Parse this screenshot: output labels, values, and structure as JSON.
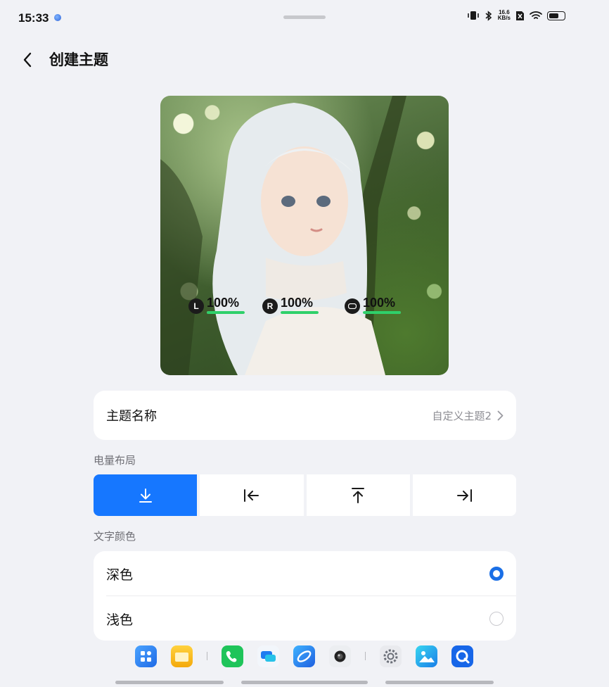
{
  "status_bar": {
    "time": "15:33",
    "net_speed_value": "16.6",
    "net_speed_unit": "KB/s",
    "battery_level": 0.7
  },
  "header": {
    "title": "创建主题"
  },
  "preview": {
    "batteries": [
      {
        "badge": "L",
        "percent": "100%",
        "level": 1.0
      },
      {
        "badge": "R",
        "percent": "100%",
        "level": 1.0
      },
      {
        "badge": "",
        "percent": "100%",
        "level": 1.0
      }
    ],
    "bar_color": "#2fd06a"
  },
  "theme_name": {
    "label": "主题名称",
    "value": "自定义主题2"
  },
  "battery_layout": {
    "label": "电量布局",
    "options": [
      "arrow-down-to-line-icon",
      "arrow-left-to-line-icon",
      "arrow-up-to-line-icon",
      "arrow-right-to-line-icon"
    ],
    "selected_index": 0,
    "accent": "#1677ff"
  },
  "text_color": {
    "label": "文字颜色",
    "options": [
      {
        "label": "深色",
        "checked": true
      },
      {
        "label": "浅色",
        "checked": false
      }
    ]
  },
  "dock": {
    "apps": [
      "app-store-icon",
      "file-manager-icon",
      "phone-icon",
      "messages-icon",
      "browser-icon",
      "camera-icon",
      "settings-icon",
      "gallery-icon",
      "search-icon"
    ]
  }
}
